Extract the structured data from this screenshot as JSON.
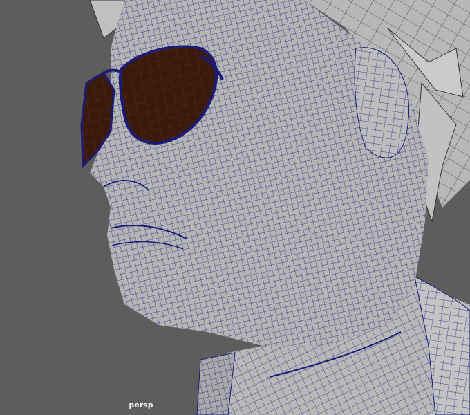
{
  "viewport": {
    "camera_label": "persp",
    "colors": {
      "background": "#5d5d5d",
      "surface": "#b4b4b4",
      "wireframe": "#1a1a7a",
      "lens": "#3a1a0c"
    }
  }
}
